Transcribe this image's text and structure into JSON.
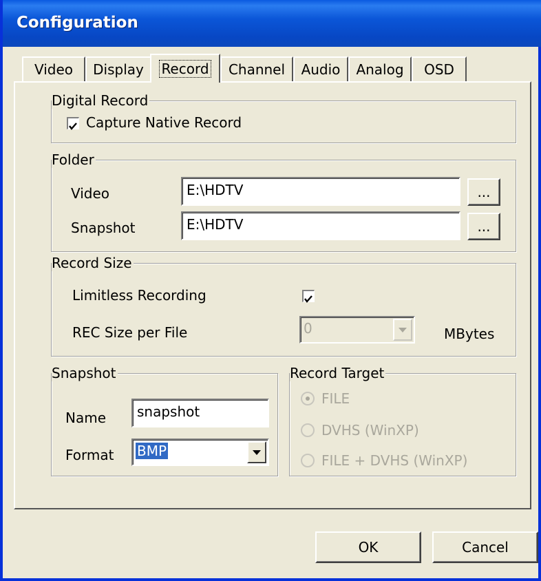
{
  "window": {
    "title": "Configuration"
  },
  "tabs": [
    {
      "label": "Video"
    },
    {
      "label": "Display"
    },
    {
      "label": "Record",
      "active": true
    },
    {
      "label": "Channel"
    },
    {
      "label": "Audio"
    },
    {
      "label": "Analog"
    },
    {
      "label": "OSD"
    }
  ],
  "digital_record": {
    "title": "Digital Record",
    "capture_native": {
      "label": "Capture Native Record",
      "checked": true
    }
  },
  "folder": {
    "title": "Folder",
    "video": {
      "label": "Video",
      "value": "E:\\HDTV",
      "browse_label": "..."
    },
    "snapshot": {
      "label": "Snapshot",
      "value": "E:\\HDTV",
      "browse_label": "..."
    }
  },
  "record_size": {
    "title": "Record Size",
    "limitless": {
      "label": "Limitless Recording",
      "checked": true
    },
    "rec_size": {
      "label": "REC Size per File",
      "value": "0",
      "unit": "MBytes",
      "enabled": false
    }
  },
  "snapshot": {
    "title": "Snapshot",
    "name": {
      "label": "Name",
      "value": "snapshot"
    },
    "format": {
      "label": "Format",
      "value": "BMP"
    }
  },
  "record_target": {
    "title": "Record Target",
    "enabled": false,
    "options": [
      {
        "label": "FILE",
        "selected": true
      },
      {
        "label": "DVHS (WinXP)",
        "selected": false
      },
      {
        "label": "FILE + DVHS (WinXP)",
        "selected": false
      }
    ]
  },
  "buttons": {
    "ok": "OK",
    "cancel": "Cancel"
  },
  "colors": {
    "titlebar": "#0a5ae0",
    "face": "#ece9d8",
    "selection": "#316ac5"
  }
}
